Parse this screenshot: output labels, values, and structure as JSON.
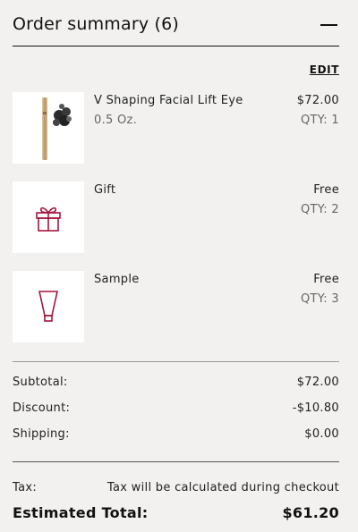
{
  "header": {
    "title": "Order summary (6)",
    "collapse_icon": "minus-icon"
  },
  "edit_label": "EDIT",
  "items": [
    {
      "name": "V Shaping Facial Lift Eye",
      "variant": "0.5 Oz.",
      "price": "$72.00",
      "qty": "QTY: 1",
      "icon": "product-image"
    },
    {
      "name": "Gift",
      "variant": "",
      "price": "Free",
      "qty": "QTY: 2",
      "icon": "gift-icon"
    },
    {
      "name": "Sample",
      "variant": "",
      "price": "Free",
      "qty": "QTY: 3",
      "icon": "sample-tube-icon"
    }
  ],
  "totals": {
    "subtotal_label": "Subtotal:",
    "subtotal_value": "$72.00",
    "discount_label": "Discount:",
    "discount_value": "-$10.80",
    "shipping_label": "Shipping:",
    "shipping_value": "$0.00",
    "tax_label": "Tax:",
    "tax_value": "Tax will be calculated during checkout",
    "estimated_label": "Estimated Total:",
    "estimated_value": "$61.20"
  },
  "colors": {
    "background": "#f2f1f0",
    "accent": "#a3153b",
    "text": "#222222"
  }
}
